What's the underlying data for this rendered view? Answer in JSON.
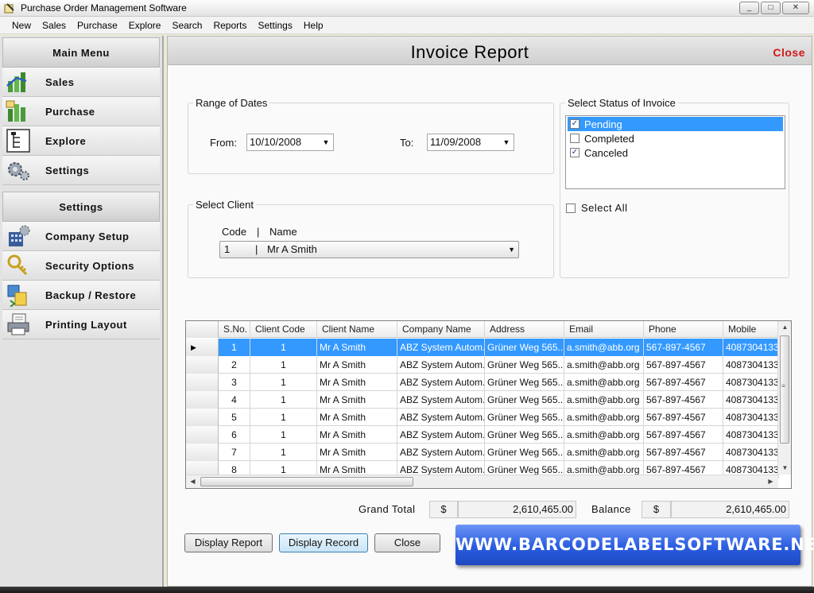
{
  "window": {
    "title": "Purchase Order Management Software",
    "controls": [
      "_",
      "□",
      "✕"
    ]
  },
  "menubar": [
    "New",
    "Sales",
    "Purchase",
    "Explore",
    "Search",
    "Reports",
    "Settings",
    "Help"
  ],
  "sidebar": {
    "main_menu_title": "Main Menu",
    "main_items": [
      {
        "label": "Sales",
        "icon": "sales-chart-icon"
      },
      {
        "label": "Purchase",
        "icon": "purchase-chart-icon"
      },
      {
        "label": "Explore",
        "icon": "explore-tree-icon"
      },
      {
        "label": "Settings",
        "icon": "gears-icon"
      }
    ],
    "settings_title": "Settings",
    "settings_items": [
      {
        "label": "Company Setup",
        "icon": "company-building-icon"
      },
      {
        "label": "Security Options",
        "icon": "keys-icon"
      },
      {
        "label": "Backup / Restore",
        "icon": "backup-icon"
      },
      {
        "label": "Printing Layout",
        "icon": "printer-icon"
      }
    ]
  },
  "report": {
    "title": "Invoice Report",
    "close_link": "Close",
    "range_legend": "Range of Dates",
    "from_label": "From:",
    "from_value": "10/10/2008",
    "to_label": "To:",
    "to_value": "11/09/2008",
    "client_legend": "Select Client",
    "client_header_code": "Code",
    "client_header_sep": "|",
    "client_header_name": "Name",
    "client_code": "1",
    "client_sep": "|",
    "client_name": "Mr A Smith",
    "status_legend": "Select Status of Invoice",
    "statuses": [
      {
        "label": "Pending",
        "checked": true,
        "selected": true
      },
      {
        "label": "Completed",
        "checked": false,
        "selected": false
      },
      {
        "label": "Canceled",
        "checked": true,
        "selected": false
      }
    ],
    "select_all_label": "Select All",
    "check_mark": "✓"
  },
  "grid": {
    "columns": [
      "S.No.",
      "Client Code",
      "Client Name",
      "Company Name",
      "Address",
      "Email",
      "Phone",
      "Mobile"
    ],
    "current_row_marker": "▶",
    "scroll_grip": "≡",
    "rows": [
      [
        "1",
        "1",
        "Mr A Smith",
        "ABZ System Autom...",
        "Grüner Weg 565...",
        "a.smith@abb.org",
        "567-897-4567",
        "4087304133"
      ],
      [
        "2",
        "1",
        "Mr A Smith",
        "ABZ System Autom...",
        "Grüner Weg 565...",
        "a.smith@abb.org",
        "567-897-4567",
        "4087304133"
      ],
      [
        "3",
        "1",
        "Mr A Smith",
        "ABZ System Autom...",
        "Grüner Weg 565...",
        "a.smith@abb.org",
        "567-897-4567",
        "4087304133"
      ],
      [
        "4",
        "1",
        "Mr A Smith",
        "ABZ System Autom...",
        "Grüner Weg 565...",
        "a.smith@abb.org",
        "567-897-4567",
        "4087304133"
      ],
      [
        "5",
        "1",
        "Mr A Smith",
        "ABZ System Autom...",
        "Grüner Weg 565...",
        "a.smith@abb.org",
        "567-897-4567",
        "4087304133"
      ],
      [
        "6",
        "1",
        "Mr A Smith",
        "ABZ System Autom...",
        "Grüner Weg 565...",
        "a.smith@abb.org",
        "567-897-4567",
        "4087304133"
      ],
      [
        "7",
        "1",
        "Mr A Smith",
        "ABZ System Autom...",
        "Grüner Weg 565...",
        "a.smith@abb.org",
        "567-897-4567",
        "4087304133"
      ],
      [
        "8",
        "1",
        "Mr A Smith",
        "ABZ System Autom...",
        "Grüner Weg 565...",
        "a.smith@abb.org",
        "567-897-4567",
        "4087304133"
      ]
    ]
  },
  "totals": {
    "grand_total_label": "Grand Total",
    "grand_total_currency": "$",
    "grand_total_value": "2,610,465.00",
    "balance_label": "Balance",
    "balance_currency": "$",
    "balance_value": "2,610,465.00"
  },
  "buttons": {
    "display_report": "Display Report",
    "display_record": "Display Record",
    "close": "Close"
  },
  "banner": {
    "text": "WWW.BARCODELABELSOFTWARE.NET"
  },
  "colors": {
    "selection": "#3399ff",
    "close_red": "#d01818",
    "banner_blue": "#2a5de0"
  }
}
